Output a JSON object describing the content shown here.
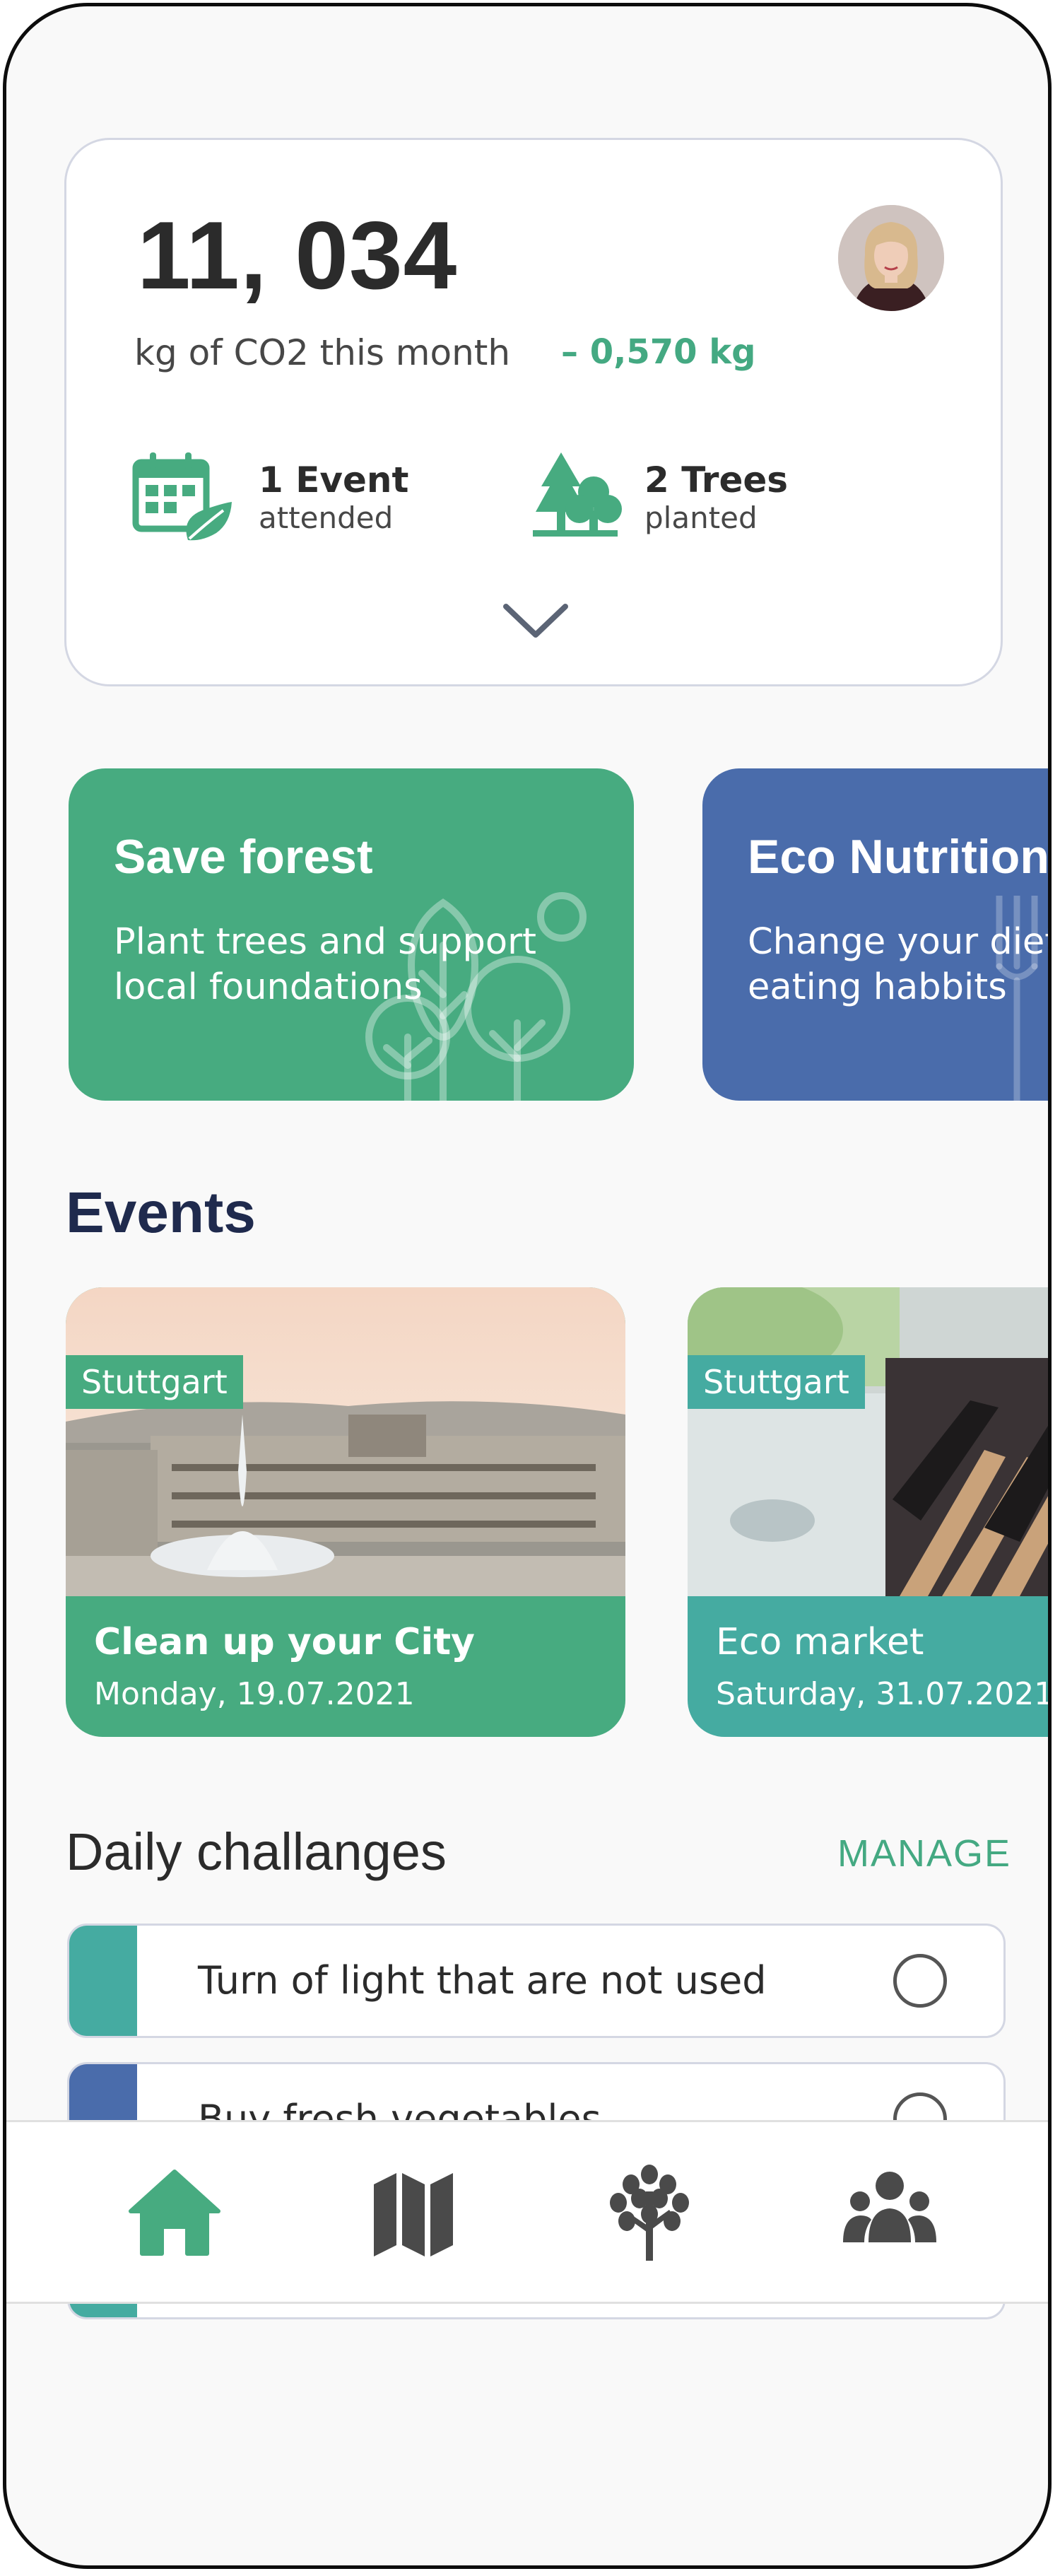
{
  "stats": {
    "co2_value": "11, 034",
    "co2_label": "kg of CO2 this month",
    "co2_delta": "– 0,570 kg",
    "events_title": "1 Event",
    "events_sub": "attended",
    "trees_title": "2 Trees",
    "trees_sub": "planted"
  },
  "topics": [
    {
      "title": "Save forest",
      "desc_line1": "Plant trees and support",
      "desc_line2": "local foundations",
      "color": "#47ab80"
    },
    {
      "title": "Eco Nutrition",
      "desc_line1": "Change your diet",
      "desc_line2": "eating habbits",
      "color": "#4a6cab"
    }
  ],
  "events": {
    "title": "Events",
    "items": [
      {
        "city": "Stuttgart",
        "name": "Clean up your City",
        "date": "Monday, 19.07.2021"
      },
      {
        "city": "Stuttgart",
        "name": "Eco market",
        "date": "Saturday, 31.07.2021"
      }
    ]
  },
  "challenges": {
    "title": "Daily challanges",
    "manage_label": "MANAGE",
    "items": [
      {
        "text": "Turn of light that are not used",
        "color": "#45aba1"
      },
      {
        "text": "Buy fresh vegetables",
        "color": "#4a6cab"
      },
      {
        "text": "",
        "color": "#45aba1"
      }
    ]
  },
  "nav": {
    "items": [
      {
        "icon": "home-icon",
        "active": true
      },
      {
        "icon": "map-icon",
        "active": false
      },
      {
        "icon": "tree-icon",
        "active": false
      },
      {
        "icon": "community-icon",
        "active": false
      }
    ]
  },
  "colors": {
    "accent_green": "#47ab80",
    "accent_teal": "#45aba1",
    "accent_blue": "#4a6cab",
    "heading_navy": "#1f2a4d",
    "text_dark": "#2b2b2b"
  }
}
